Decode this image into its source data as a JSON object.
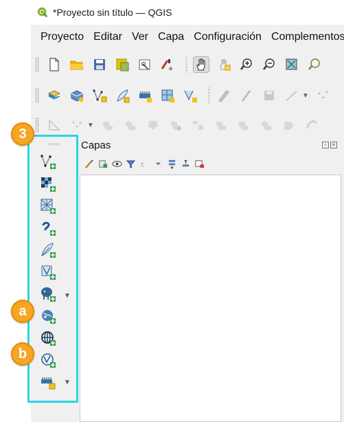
{
  "window": {
    "title": "*Proyecto sin título — QGIS",
    "app_icon": "qgis-logo-icon"
  },
  "menubar": {
    "items": [
      {
        "label": "Proyecto"
      },
      {
        "label": "Editar"
      },
      {
        "label": "Ver"
      },
      {
        "label": "Capa"
      },
      {
        "label": "Configuración"
      },
      {
        "label": "Complementos"
      }
    ]
  },
  "panel": {
    "title": "Capas"
  },
  "annotations": {
    "step_number": "3",
    "marker_a": "a",
    "marker_b": "b"
  },
  "colors": {
    "highlight": "#2ad3e3",
    "badge": "#f5a623"
  },
  "left_toolbar": {
    "buttons": [
      "add-vector-layer-icon",
      "add-raster-layer-icon",
      "add-mesh-layer-icon",
      "add-delimited-text-layer-icon",
      "add-gps-data-icon",
      "add-spatialite-layer-icon",
      "add-postgis-layer-icon",
      "add-wms-wmts-layer-icon",
      "add-xyz-layer-icon",
      "add-wfs-layer-icon",
      "add-virtual-layer-icon"
    ]
  }
}
